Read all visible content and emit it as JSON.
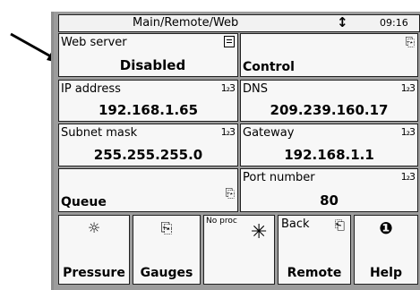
{
  "statusbar": {
    "title": "Main/Remote/Web",
    "status_icon": "↕",
    "time": "09:16"
  },
  "tiles": {
    "web_server": {
      "label": "Web server",
      "value": "Disabled"
    },
    "control": {
      "label": "Control"
    },
    "ip_address": {
      "label": "IP address",
      "value": "192.168.1.65",
      "icon": "1₂3"
    },
    "dns": {
      "label": "DNS",
      "value": "209.239.160.17",
      "icon": "1₂3"
    },
    "subnet_mask": {
      "label": "Subnet mask",
      "value": "255.255.255.0",
      "icon": "1₂3"
    },
    "gateway": {
      "label": "Gateway",
      "value": "192.168.1.1",
      "icon": "1₂3"
    },
    "queue": {
      "label": "Queue"
    },
    "port_number": {
      "label": "Port number",
      "value": "80",
      "icon": "1₂3"
    }
  },
  "buttons": {
    "pressure": {
      "label": "Pressure",
      "icon": "gauge-sun-icon"
    },
    "gauges": {
      "label": "Gauges",
      "icon": "panel-arrow-icon"
    },
    "no_proc": {
      "label": "No proc",
      "icon": "asterisk-icon"
    },
    "remote": {
      "label": "Remote",
      "back_label": "Back",
      "icon": "back-panel-icon"
    },
    "help": {
      "label": "Help",
      "icon": "info-icon"
    }
  }
}
